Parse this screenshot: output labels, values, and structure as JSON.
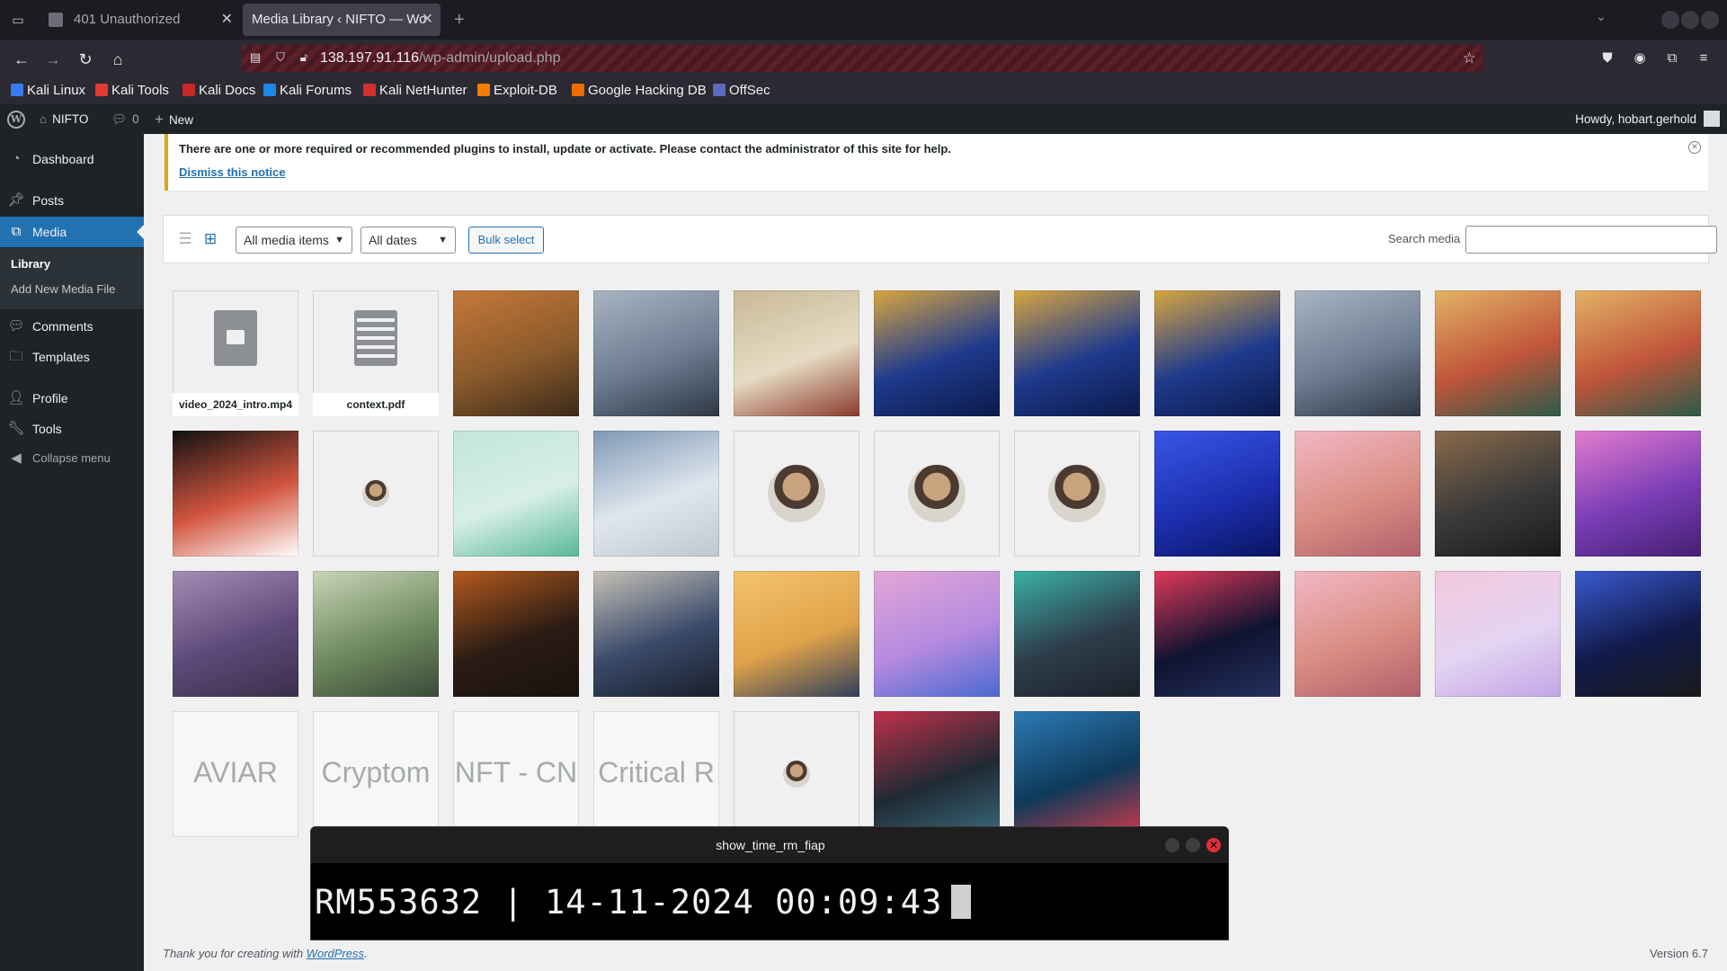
{
  "browser": {
    "tabs": [
      {
        "label": "401 Unauthorized",
        "active": false
      },
      {
        "label": "Media Library ‹ NIFTO — Wo",
        "active": true
      }
    ],
    "url_host": "138.197.91.116",
    "url_path": "/wp-admin/upload.php",
    "bookmarks": [
      {
        "label": "Kali Linux",
        "color": "#367bf0"
      },
      {
        "label": "Kali Tools",
        "color": "#e53935"
      },
      {
        "label": "Kali Docs",
        "color": "#c62828"
      },
      {
        "label": "Kali Forums",
        "color": "#1e88e5"
      },
      {
        "label": "Kali NetHunter",
        "color": "#d32f2f"
      },
      {
        "label": "Exploit-DB",
        "color": "#f57c00"
      },
      {
        "label": "Google Hacking DB",
        "color": "#ef6c00"
      },
      {
        "label": "OffSec",
        "color": "#5c6bc0"
      }
    ]
  },
  "adminbar": {
    "site_name": "NIFTO",
    "comments_count": "0",
    "new_label": "New",
    "greeting": "Howdy, hobart.gerhold"
  },
  "sidebar": {
    "items": [
      {
        "label": "Dashboard",
        "icon": "dashboard-icon"
      },
      {
        "label": "Posts",
        "icon": "pin-icon"
      },
      {
        "label": "Media",
        "icon": "media-icon"
      },
      {
        "label": "Comments",
        "icon": "comment-icon"
      },
      {
        "label": "Templates",
        "icon": "folder-icon"
      },
      {
        "label": "Profile",
        "icon": "user-icon"
      },
      {
        "label": "Tools",
        "icon": "wrench-icon"
      },
      {
        "label": "Collapse menu",
        "icon": "collapse-icon"
      }
    ],
    "submenu": [
      "Library",
      "Add New Media File"
    ]
  },
  "notice": {
    "message": "There are one or more required or recommended plugins to install, update or activate. Please contact the administrator of this site for help.",
    "dismiss": "Dismiss this notice"
  },
  "toolbar": {
    "filter_type": "All media items",
    "filter_date": "All dates",
    "bulk_select": "Bulk select",
    "search_label": "Search media",
    "search_value": ""
  },
  "media": {
    "items": [
      {
        "kind": "video",
        "caption": "video_2024_intro.mp4"
      },
      {
        "kind": "doc",
        "caption": "context.pdf"
      },
      {
        "kind": "img",
        "colors": [
          "#8a5a2b",
          "#c6783a",
          "#3c2a1a"
        ]
      },
      {
        "kind": "img",
        "colors": [
          "#6e7d92",
          "#a9b4c2",
          "#2e3744"
        ]
      },
      {
        "kind": "img",
        "colors": [
          "#e6dcc4",
          "#c8b996",
          "#8b3a2b"
        ]
      },
      {
        "kind": "img",
        "colors": [
          "#1e3a8c",
          "#d9a640",
          "#0c1a4a"
        ]
      },
      {
        "kind": "img",
        "colors": [
          "#1e3a8c",
          "#d9a640",
          "#0c1a4a"
        ]
      },
      {
        "kind": "img",
        "colors": [
          "#1e3a8c",
          "#d9a640",
          "#0c1a4a"
        ]
      },
      {
        "kind": "img",
        "colors": [
          "#6e7d92",
          "#a9b4c2",
          "#2e3744"
        ]
      },
      {
        "kind": "img",
        "colors": [
          "#c0563a",
          "#e3b266",
          "#2c5a4a"
        ]
      },
      {
        "kind": "img",
        "colors": [
          "#c0563a",
          "#e3b266",
          "#2c5a4a"
        ]
      },
      {
        "kind": "img",
        "colors": [
          "#d2553f",
          "#111111",
          "#ffffff"
        ]
      },
      {
        "kind": "avatar-sm"
      },
      {
        "kind": "img",
        "colors": [
          "#d8efe6",
          "#c1e6d7",
          "#59b897"
        ]
      },
      {
        "kind": "img",
        "colors": [
          "#dfe6ee",
          "#7f99b5",
          "#bfc7cf"
        ]
      },
      {
        "kind": "avatar"
      },
      {
        "kind": "avatar"
      },
      {
        "kind": "avatar"
      },
      {
        "kind": "img",
        "colors": [
          "#1c2fb0",
          "#3a56e6",
          "#0a1460"
        ]
      },
      {
        "kind": "img",
        "colors": [
          "#d98e84",
          "#f2b7c4",
          "#b35f6b"
        ]
      },
      {
        "kind": "img",
        "colors": [
          "#3a3a3a",
          "#8a6a4a",
          "#1a1a1a"
        ]
      },
      {
        "kind": "img",
        "colors": [
          "#7a3db5",
          "#e37ccf",
          "#452073"
        ]
      },
      {
        "kind": "img",
        "colors": [
          "#5e4a7a",
          "#a58cb5",
          "#3a2f4a"
        ]
      },
      {
        "kind": "img",
        "colors": [
          "#6e8a5e",
          "#c9d4b8",
          "#3a4a3a"
        ]
      },
      {
        "kind": "img",
        "colors": [
          "#2a1c14",
          "#b55a1e",
          "#1a120c"
        ]
      },
      {
        "kind": "img",
        "colors": [
          "#3a4a6a",
          "#c7c2b8",
          "#1a1f2a"
        ]
      },
      {
        "kind": "img",
        "colors": [
          "#e0a24a",
          "#f3c46b",
          "#30405a"
        ]
      },
      {
        "kind": "img",
        "colors": [
          "#b58adf",
          "#e2a6d6",
          "#4a6ad0"
        ]
      },
      {
        "kind": "img",
        "colors": [
          "#2e3c4a",
          "#3ab0a6",
          "#1a222a"
        ]
      },
      {
        "kind": "img",
        "colors": [
          "#0e1330",
          "#e03a5a",
          "#26305e"
        ]
      },
      {
        "kind": "img",
        "colors": [
          "#d98e84",
          "#f2b7c4",
          "#b35f6b"
        ]
      },
      {
        "kind": "img",
        "colors": [
          "#e4d4f2",
          "#f2c8dc",
          "#c2a6e6"
        ]
      },
      {
        "kind": "img",
        "colors": [
          "#111a4a",
          "#3a5ad0",
          "#1a1a1a"
        ]
      },
      {
        "kind": "logo",
        "text": "AVIAR"
      },
      {
        "kind": "logo",
        "text": "Cryptom"
      },
      {
        "kind": "logo",
        "text": "NFT - CN"
      },
      {
        "kind": "logo",
        "text": "Critical R"
      },
      {
        "kind": "avatar-sm"
      },
      {
        "kind": "img",
        "colors": [
          "#1f2a34",
          "#c0304a",
          "#3a6a7a"
        ]
      },
      {
        "kind": "img",
        "colors": [
          "#0e3a5a",
          "#2d7ab5",
          "#d13a4a"
        ]
      }
    ]
  },
  "footer": {
    "thanks_prefix": "Thank you for creating with",
    "thanks_link": "WordPress",
    "thanks_suffix": ".",
    "version": "Version 6.7"
  },
  "terminal": {
    "title": "show_time_rm_fiap",
    "text": "RM553632 | 14-11-2024 00:09:43"
  }
}
